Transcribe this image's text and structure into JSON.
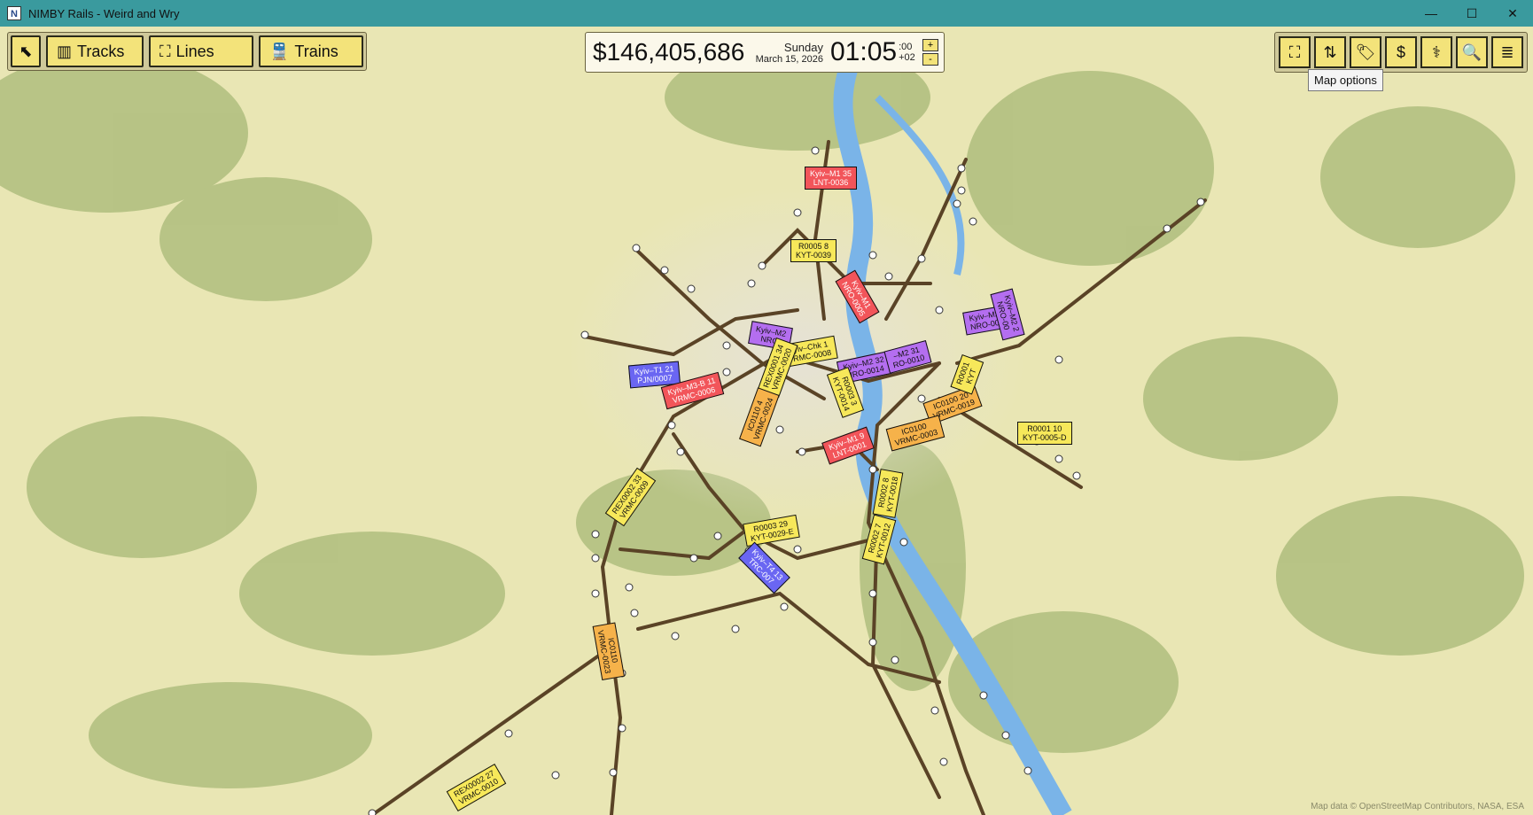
{
  "window": {
    "app_icon": "N",
    "title": "NIMBY Rails - Weird and Wry",
    "minimize": "—",
    "maximize": "☐",
    "close": "✕"
  },
  "toolbar": {
    "cursor_icon": "⬉",
    "tracks_label": "Tracks",
    "tracks_icon": "▥",
    "lines_label": "Lines",
    "lines_icon": "⛶",
    "trains_label": "Trains",
    "trains_icon": "🚆"
  },
  "status": {
    "money": "$146,405,686",
    "day": "Sunday",
    "date": "March 15, 2026",
    "time": "01:05",
    "seconds": ":00",
    "offset": "+02",
    "speed_up": "+",
    "speed_down": "-"
  },
  "tools": [
    {
      "name": "map-options-icon",
      "glyph": "⛶"
    },
    {
      "name": "sort-icon",
      "glyph": "⇅"
    },
    {
      "name": "tag-icon",
      "glyph": "🏷"
    },
    {
      "name": "dollar-icon",
      "glyph": "$"
    },
    {
      "name": "stats-icon",
      "glyph": "⚕"
    },
    {
      "name": "search-icon",
      "glyph": "🔍"
    },
    {
      "name": "menu-icon",
      "glyph": "≣"
    }
  ],
  "tooltip": "Map options",
  "trains": [
    {
      "l1": "Kyiv–M1 35",
      "l2": "LNT-0036",
      "color": "red"
    },
    {
      "l1": "R0005 8",
      "l2": "KYT-0039",
      "color": "yellow"
    },
    {
      "l1": "Kyiv–M1",
      "l2": "NRO-0005",
      "color": "red"
    },
    {
      "l1": "Kyiv–M2 1",
      "l2": "NRO-0011",
      "color": "purple"
    },
    {
      "l1": "Kyiv–M2",
      "l2": "NRO",
      "color": "purple"
    },
    {
      "l1": "Kyiv–Chk 1",
      "l2": "VRMC-0008",
      "color": "yellow"
    },
    {
      "l1": "Kyiv–M2 32",
      "l2": "NRO-0014",
      "color": "purple"
    },
    {
      "l1": "–M2 31",
      "l2": "RO-0010",
      "color": "purple"
    },
    {
      "l1": "Kyiv–T1 21",
      "l2": "PJN/0007",
      "color": "blue"
    },
    {
      "l1": "Kyiv–M3-B 11",
      "l2": "VRMC-0006",
      "color": "red"
    },
    {
      "l1": "REX0001 34",
      "l2": "VRMC-0020",
      "color": "yellow"
    },
    {
      "l1": "IC0110 4",
      "l2": "VRMC-0024",
      "color": "orange"
    },
    {
      "l1": "R0003 3",
      "l2": "KYT-0014",
      "color": "yellow"
    },
    {
      "l1": "IC0100 20",
      "l2": "VRMC-0019",
      "color": "orange"
    },
    {
      "l1": "IC0100",
      "l2": "VRMC-0003",
      "color": "orange"
    },
    {
      "l1": "Kyiv–M1 9",
      "l2": "LNT-0001",
      "color": "red"
    },
    {
      "l1": "R0001 10",
      "l2": "KYT-0005-D",
      "color": "yellow"
    },
    {
      "l1": "REX0002 33",
      "l2": "VRMC-0009",
      "color": "yellow"
    },
    {
      "l1": "R0003 29",
      "l2": "KYT-0029-E",
      "color": "yellow"
    },
    {
      "l1": "R0002 8",
      "l2": "KYT-0018",
      "color": "yellow"
    },
    {
      "l1": "R0002 7",
      "l2": "KYT-0012",
      "color": "yellow"
    },
    {
      "l1": "Kyiv–T4 13",
      "l2": "TRC-007",
      "color": "blue"
    },
    {
      "l1": "IC0110",
      "l2": "VRMC-0023",
      "color": "orange"
    },
    {
      "l1": "REX0002 27",
      "l2": "VRMC-0010",
      "color": "yellow"
    },
    {
      "l1": "Kyiv–M2 2",
      "l2": "NRO-00",
      "color": "purple"
    },
    {
      "l1": "R0001",
      "l2": "KYT",
      "color": "yellow"
    }
  ],
  "attribution": "Map data © OpenStreetMap Contributors, NASA, ESA"
}
